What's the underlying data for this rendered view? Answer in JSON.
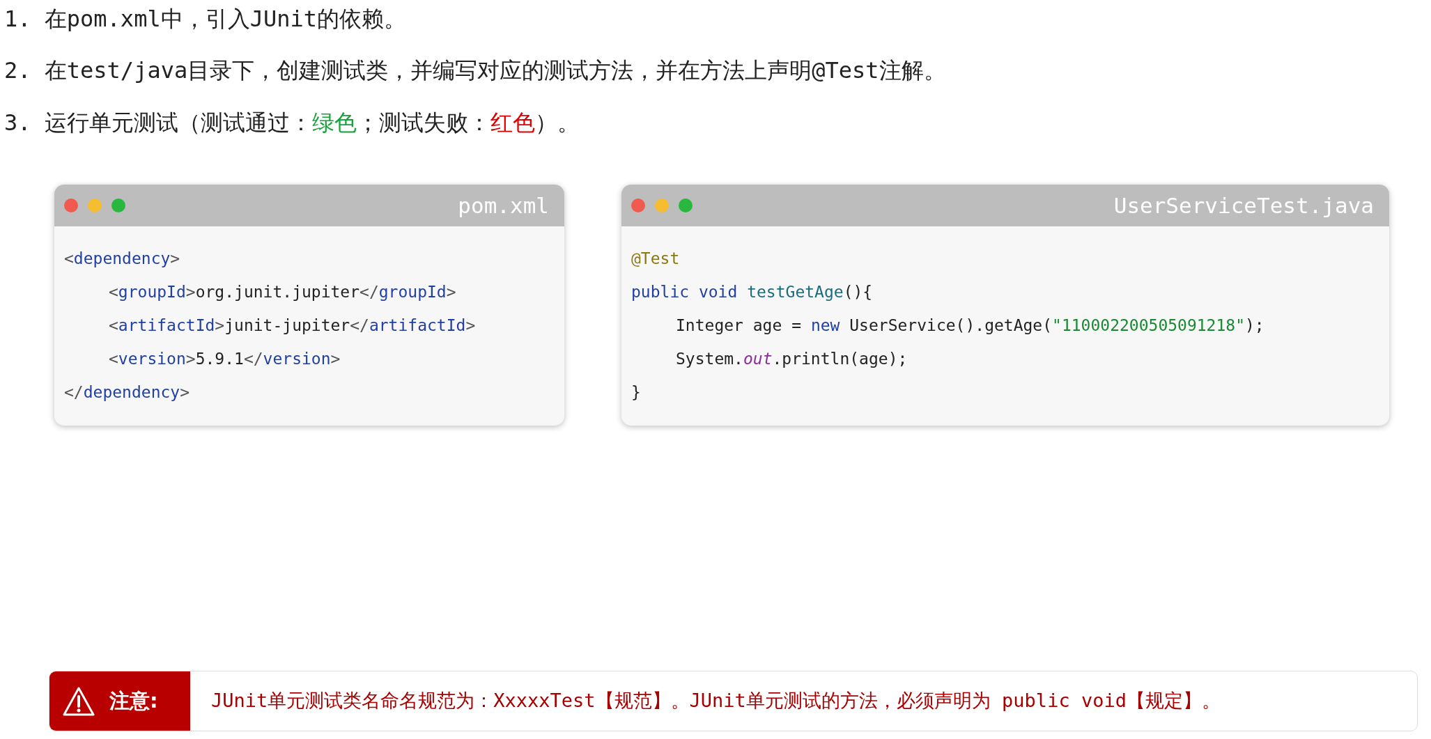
{
  "steps": [
    {
      "number": "1.",
      "segments": [
        {
          "kind": "text",
          "text": "在pom.xml中，引入JUnit的依赖。"
        }
      ]
    },
    {
      "number": "2.",
      "segments": [
        {
          "kind": "text",
          "text": "在test/java目录下，创建测试类，并编写对应的测试方法，并在方法上声明@Test注解。"
        }
      ]
    },
    {
      "number": "3.",
      "segments": [
        {
          "kind": "text",
          "text": "运行单元测试（测试通过："
        },
        {
          "kind": "pass",
          "text": "绿色"
        },
        {
          "kind": "text",
          "text": "；测试失败："
        },
        {
          "kind": "fail",
          "text": "红色"
        },
        {
          "kind": "text",
          "text": "）。"
        }
      ]
    }
  ],
  "code_windows": [
    {
      "filename": "pom.xml",
      "lines": [
        {
          "tokens": [
            {
              "kind": "punct",
              "text": "<"
            },
            {
              "kind": "tag",
              "text": "dependency"
            },
            {
              "kind": "punct",
              "text": ">"
            }
          ],
          "children": [
            {
              "tokens": [
                {
                  "kind": "punct",
                  "text": "<"
                },
                {
                  "kind": "tag",
                  "text": "groupId"
                },
                {
                  "kind": "punct",
                  "text": ">"
                },
                {
                  "kind": "plain",
                  "text": "org.junit.jupiter"
                },
                {
                  "kind": "punct",
                  "text": "</"
                },
                {
                  "kind": "tag",
                  "text": "groupId"
                },
                {
                  "kind": "punct",
                  "text": ">"
                }
              ]
            },
            {
              "tokens": [
                {
                  "kind": "punct",
                  "text": "<"
                },
                {
                  "kind": "tag",
                  "text": "artifactId"
                },
                {
                  "kind": "punct",
                  "text": ">"
                },
                {
                  "kind": "plain",
                  "text": "junit-jupiter"
                },
                {
                  "kind": "punct",
                  "text": "</"
                },
                {
                  "kind": "tag",
                  "text": "artifactId"
                },
                {
                  "kind": "punct",
                  "text": ">"
                }
              ]
            },
            {
              "tokens": [
                {
                  "kind": "punct",
                  "text": "<"
                },
                {
                  "kind": "tag",
                  "text": "version"
                },
                {
                  "kind": "punct",
                  "text": ">"
                },
                {
                  "kind": "plain",
                  "text": "5.9.1"
                },
                {
                  "kind": "punct",
                  "text": "</"
                },
                {
                  "kind": "tag",
                  "text": "version"
                },
                {
                  "kind": "punct",
                  "text": ">"
                }
              ]
            }
          ]
        },
        {
          "tokens": [
            {
              "kind": "punct",
              "text": "</"
            },
            {
              "kind": "tag",
              "text": "dependency"
            },
            {
              "kind": "punct",
              "text": ">"
            }
          ]
        }
      ]
    },
    {
      "filename": "UserServiceTest.java",
      "lines": [
        {
          "tokens": [
            {
              "kind": "annotation",
              "text": "@Test"
            }
          ]
        },
        {
          "tokens": [
            {
              "kind": "keyword",
              "text": "public void "
            },
            {
              "kind": "method",
              "text": "testGetAge"
            },
            {
              "kind": "plain",
              "text": "(){"
            }
          ],
          "children": [
            {
              "tokens": [
                {
                  "kind": "plain",
                  "text": "Integer age = "
                },
                {
                  "kind": "keyword",
                  "text": "new"
                },
                {
                  "kind": "plain",
                  "text": " UserService().getAge("
                },
                {
                  "kind": "string",
                  "text": "\"110002200505091218\""
                },
                {
                  "kind": "plain",
                  "text": ");"
                }
              ]
            },
            {
              "tokens": [
                {
                  "kind": "plain",
                  "text": "System."
                },
                {
                  "kind": "field",
                  "text": "out"
                },
                {
                  "kind": "plain",
                  "text": ".println(age);"
                }
              ]
            }
          ]
        },
        {
          "tokens": [
            {
              "kind": "plain",
              "text": "}"
            }
          ]
        }
      ]
    }
  ],
  "notice": {
    "label": "注意:",
    "text": "JUnit单元测试类名命名规范为：XxxxxTest【规范】。JUnit单元测试的方法，必须声明为 public void【规定】。"
  }
}
